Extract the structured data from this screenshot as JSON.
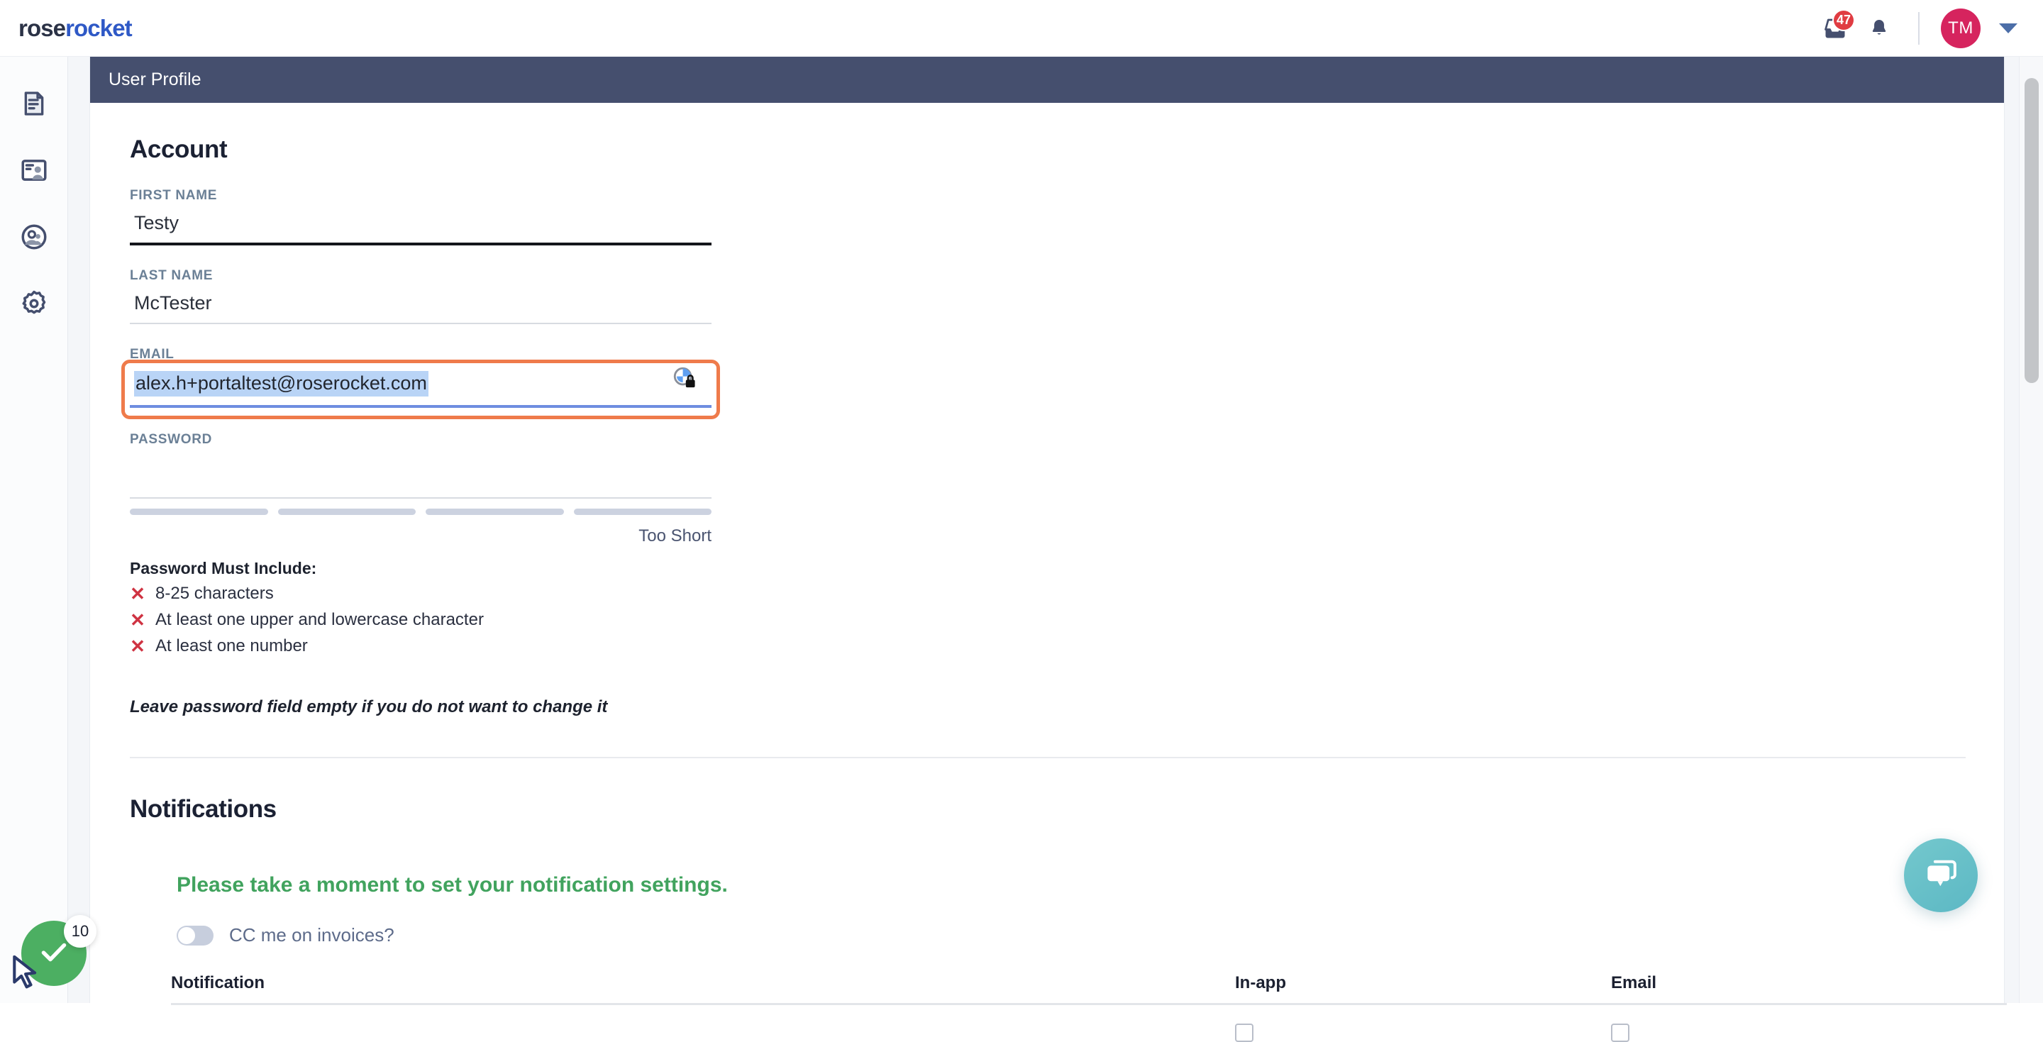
{
  "brand": {
    "logo_part1": "rose",
    "logo_part2": "rocket",
    "logo_color_1": "#2b3246",
    "logo_color_2": "#2f59c6"
  },
  "topbar": {
    "inbox_badge": "47",
    "avatar_initials": "TM",
    "avatar_color": "#d6245e",
    "badge_color": "#e03c42"
  },
  "sidebar": {
    "items": [
      {
        "name": "orders-icon",
        "label": "Orders"
      },
      {
        "name": "profile-card-icon",
        "label": "Profile"
      },
      {
        "name": "contacts-icon",
        "label": "Contacts"
      },
      {
        "name": "settings-gear-icon",
        "label": "Settings"
      }
    ]
  },
  "page": {
    "header_title": "User Profile",
    "header_bg": "#454f6e"
  },
  "account": {
    "section_title": "Account",
    "fields": [
      {
        "label": "FIRST NAME",
        "value": "Testy",
        "placeholder": ""
      },
      {
        "label": "LAST NAME",
        "value": "McTester",
        "placeholder": ""
      }
    ],
    "email": {
      "label": "EMAIL",
      "value": "alex.h+portaltest@roserocket.com",
      "focus_ring_color": "#ef7b4b",
      "selection_color": "#b9d4f6",
      "underline_color": "#6e8de0"
    },
    "password": {
      "label": "PASSWORD",
      "value": "",
      "strength_label": "Too Short",
      "strength_segments": [
        0,
        0,
        0,
        0
      ],
      "requirements_title": "Password Must Include:",
      "requirements": [
        {
          "status": "fail",
          "text": "8-25 characters"
        },
        {
          "status": "fail",
          "text": "At least one upper and lowercase character"
        },
        {
          "status": "fail",
          "text": "At least one number"
        }
      ],
      "hint": "Leave password field empty if you do not want to change it"
    }
  },
  "notifications": {
    "section_title": "Notifications",
    "prompt": "Please take a moment to set your notification settings.",
    "prompt_color": "#41a35e",
    "cc_toggle": {
      "label": "CC me on invoices?",
      "state": "off"
    },
    "table": {
      "columns": [
        "Notification",
        "In-app",
        "Email"
      ],
      "rows": []
    }
  },
  "widgets": {
    "chat": {
      "name": "chat-bubble",
      "color": "#5cb8c4"
    },
    "task": {
      "name": "task-complete",
      "badge": "10",
      "color": "#4caf62"
    }
  }
}
